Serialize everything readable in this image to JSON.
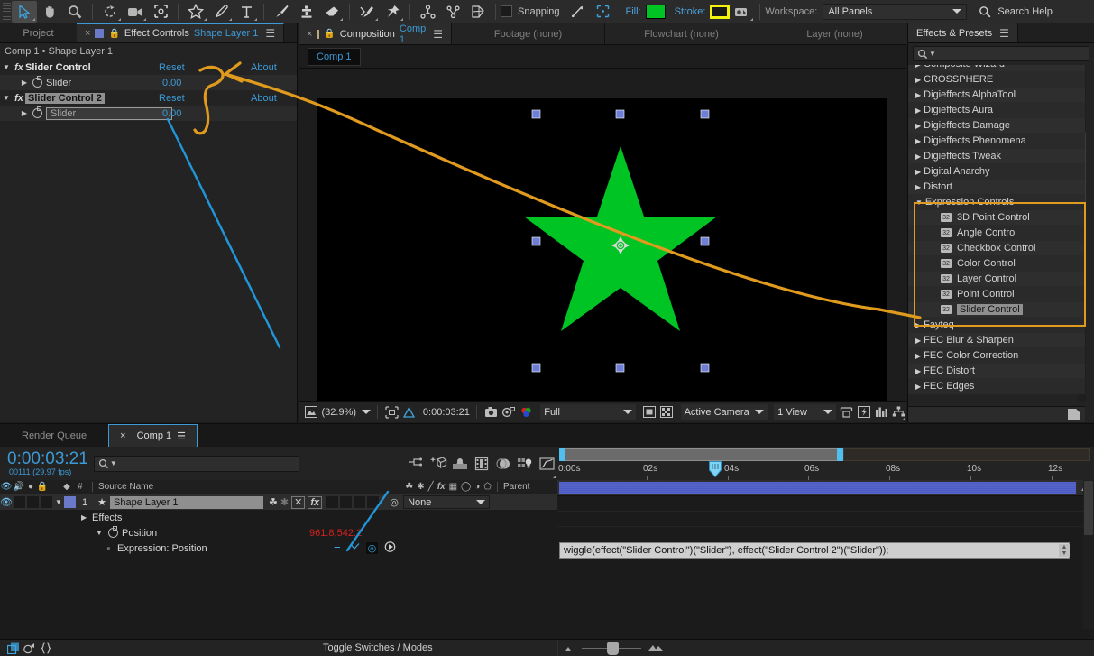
{
  "toolbar": {
    "tools": [
      {
        "name": "selection-tool",
        "icon": "arrow-cursor",
        "selected": true
      },
      {
        "name": "hand-tool",
        "icon": "hand"
      },
      {
        "name": "zoom-tool",
        "icon": "magnifier"
      },
      {
        "name": "rotation-tool",
        "icon": "rotate"
      },
      {
        "name": "camera-tool",
        "icon": "camera"
      },
      {
        "name": "pan-behind-tool",
        "icon": "anchor-point"
      },
      {
        "name": "shape-tool",
        "icon": "star"
      },
      {
        "name": "pen-tool",
        "icon": "pen"
      },
      {
        "name": "type-tool",
        "icon": "text-T"
      },
      {
        "name": "brush-tool",
        "icon": "paintbrush"
      },
      {
        "name": "clone-stamp-tool",
        "icon": "stamp"
      },
      {
        "name": "eraser-tool",
        "icon": "eraser"
      },
      {
        "name": "roto-brush-tool",
        "icon": "roto-brush"
      },
      {
        "name": "puppet-pin-tool",
        "icon": "pushpin"
      },
      {
        "name": "puppet-overlap-tool",
        "icon": "puppet-overlap"
      },
      {
        "name": "puppet-starch-tool",
        "icon": "puppet-starch"
      },
      {
        "name": "puppet-mesh-tool",
        "icon": "puppet-mesh"
      }
    ],
    "snapping_label": "Snapping",
    "fill_label": "Fill:",
    "fill_color": "#00C423",
    "stroke_label": "Stroke:",
    "stroke_color": "#F2F20A",
    "workspace_label": "Workspace:",
    "workspace_value": "All Panels",
    "search_help": "Search Help"
  },
  "effect_controls": {
    "tabs": [
      {
        "label": "Project",
        "active": false
      },
      {
        "label": "Effect Controls",
        "sublabel": "Shape Layer 1",
        "active": true
      }
    ],
    "breadcrumb": "Comp 1 • Shape Layer 1",
    "effects": [
      {
        "name": "Slider Control",
        "reset": "Reset",
        "about": "About",
        "highlighted": false,
        "property": {
          "label": "Slider",
          "value": "0.00",
          "editing": false
        }
      },
      {
        "name": "Slider Control 2",
        "reset": "Reset",
        "about": "About",
        "highlighted": true,
        "property": {
          "label": "Slider",
          "value": "0.00",
          "editing": true
        }
      }
    ]
  },
  "composition": {
    "tabs": [
      {
        "label": "Composition",
        "sublabel": "Comp 1",
        "active": true
      },
      {
        "label": "Footage (none)",
        "active": false
      },
      {
        "label": "Flowchart (none)",
        "active": false
      },
      {
        "label": "Layer (none)",
        "active": false
      }
    ],
    "viewer_tab": "Comp 1",
    "shape_color": "#00C423",
    "bottom_bar": {
      "magnification": "(32.9%)",
      "timecode": "0:00:03:21",
      "resolution": "Full",
      "view": "Active Camera",
      "views": "1 View",
      "icons": [
        "toggle-transparency-grid",
        "region-of-interest",
        "toggle-mask-paths",
        "take-snapshot",
        "show-snapshot",
        "show-channel",
        "toggle-alpha-boundaries",
        "toggle-guides",
        "renderer-fast-preview",
        "timeline-button",
        "comp-flowchart-button"
      ]
    }
  },
  "effects_presets": {
    "title": "Effects & Presets",
    "search_placeholder": "",
    "items": [
      {
        "label": "Composite Wizard",
        "type": "category",
        "clipped": true
      },
      {
        "label": "CROSSPHERE",
        "type": "category"
      },
      {
        "label": "Digieffects AlphaTool",
        "type": "category"
      },
      {
        "label": "Digieffects Aura",
        "type": "category"
      },
      {
        "label": "Digieffects Damage",
        "type": "category"
      },
      {
        "label": "Digieffects Phenomena",
        "type": "category"
      },
      {
        "label": "Digieffects Tweak",
        "type": "category"
      },
      {
        "label": "Digital Anarchy",
        "type": "category"
      },
      {
        "label": "Distort",
        "type": "category"
      },
      {
        "label": "Expression Controls",
        "type": "category",
        "expanded": true
      },
      {
        "label": "3D Point Control",
        "type": "effect"
      },
      {
        "label": "Angle Control",
        "type": "effect"
      },
      {
        "label": "Checkbox Control",
        "type": "effect"
      },
      {
        "label": "Color Control",
        "type": "effect"
      },
      {
        "label": "Layer Control",
        "type": "effect"
      },
      {
        "label": "Point Control",
        "type": "effect"
      },
      {
        "label": "Slider Control",
        "type": "effect",
        "selected": true
      },
      {
        "label": "Fayteq",
        "type": "category",
        "clipped": true
      },
      {
        "label": "FEC Blur & Sharpen",
        "type": "category"
      },
      {
        "label": "FEC Color Correction",
        "type": "category"
      },
      {
        "label": "FEC Distort",
        "type": "category"
      },
      {
        "label": "FEC Edges",
        "type": "category"
      }
    ]
  },
  "timeline": {
    "tabs": [
      {
        "label": "Render Queue",
        "active": false
      },
      {
        "label": "Comp 1",
        "active": true
      }
    ],
    "current_time": "0:00:03:21",
    "frame_info": "00111 (29.97 fps)",
    "search_placeholder": "",
    "columns": [
      "#",
      "Source Name",
      "Parent"
    ],
    "switch_header_icons": [
      "eye",
      "audio",
      "solo",
      "lock",
      "label",
      "number"
    ],
    "mode_header_icons": [
      "shy",
      "collapse",
      "quality",
      "effects",
      "frame-blend",
      "motion-blur",
      "adjustment",
      "3d-layer"
    ],
    "layers": [
      {
        "index": "1",
        "name": "Shape Layer 1",
        "parent": "None",
        "bar_color": "#4d5bc4",
        "properties": [
          {
            "label": "Effects",
            "indent": 1,
            "expanded": false
          },
          {
            "label": "Position",
            "indent": 2,
            "expanded": true,
            "value": "961.8,542.2",
            "value_color": "#d42020"
          },
          {
            "label": "Expression: Position",
            "indent": 3,
            "expanded": false
          }
        ]
      }
    ],
    "expression_text": "wiggle(effect(\"Slider Control\")(\"Slider\"), effect(\"Slider Control 2\")(\"Slider\"));",
    "ruler_labels": [
      "0:00s",
      "02s",
      "04s",
      "06s",
      "08s",
      "10s",
      "12s"
    ],
    "toggle_switches_label": "Toggle Switches / Modes",
    "toolbar_icons": [
      "live-update",
      "draft-3d",
      "hide-shy-layers",
      "enable-frame-blending",
      "enable-motion-blur",
      "brainstorm",
      "graph-editor"
    ]
  },
  "annotations": {
    "arrow_color": "#E09A1E",
    "line_color": "#2196d9",
    "highlight_color": "#E09A1E"
  }
}
